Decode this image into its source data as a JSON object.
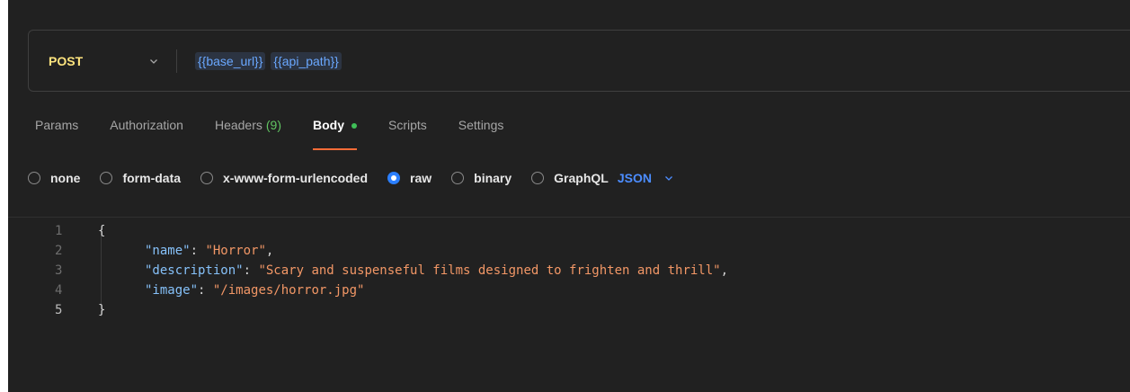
{
  "request": {
    "method": "POST",
    "url_vars": [
      "{{base_url}}",
      "{{api_path}}"
    ]
  },
  "tabs": [
    {
      "label": "Params"
    },
    {
      "label": "Authorization"
    },
    {
      "label": "Headers",
      "count": "(9)"
    },
    {
      "label": "Body",
      "active": true,
      "indicator": "green-dot"
    },
    {
      "label": "Scripts"
    },
    {
      "label": "Settings"
    }
  ],
  "body_types": [
    {
      "label": "none",
      "checked": false
    },
    {
      "label": "form-data",
      "checked": false
    },
    {
      "label": "x-www-form-urlencoded",
      "checked": false
    },
    {
      "label": "raw",
      "checked": true
    },
    {
      "label": "binary",
      "checked": false
    },
    {
      "label": "GraphQL",
      "checked": false
    }
  ],
  "language": "JSON",
  "editor": {
    "lines": [
      {
        "num": "1",
        "text": "{"
      },
      {
        "num": "2",
        "key": "\"name\"",
        "value": "\"Horror\"",
        "trail": ","
      },
      {
        "num": "3",
        "key": "\"description\"",
        "value": "\"Scary and suspenseful films designed to frighten and thrill\"",
        "trail": ","
      },
      {
        "num": "4",
        "key": "\"image\"",
        "value": "\"/images/horror.jpg\"",
        "trail": ""
      },
      {
        "num": "5",
        "text": "}"
      }
    ]
  },
  "icons": {
    "method_dropdown": "chevron-down-icon",
    "language_dropdown": "chevron-down-icon"
  },
  "colors": {
    "background": "#212121",
    "method": "#ffe47e",
    "variable": "#6aa8ff",
    "active_tab_underline": "#ff6c37",
    "radio_checked": "#2b7fff",
    "json_key": "#86c1f9",
    "json_string": "#f29766"
  }
}
